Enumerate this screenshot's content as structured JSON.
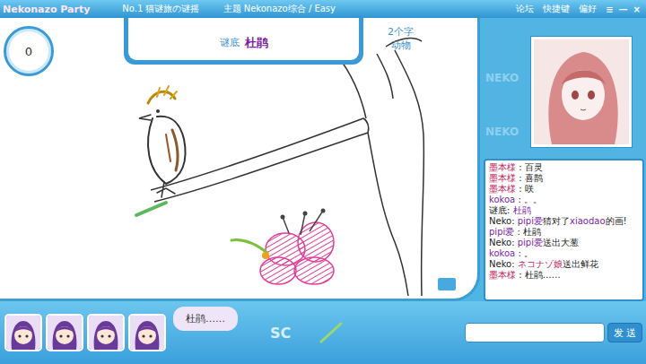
{
  "title_bar": {
    "app_name": "Nekonazo Party",
    "room": "No.1 猫谜旅の谜摇",
    "topic": "主题 Nekonazo综合 / Easy",
    "links": [
      "论坛",
      "快捷键",
      "偏好"
    ],
    "controls": [
      "≡",
      "—",
      "×"
    ]
  },
  "timer": "0",
  "answer": {
    "label": "谜底",
    "word": "杜鹃"
  },
  "hint": {
    "length": "2个字",
    "category": "动物"
  },
  "pattern_text": "NEKO",
  "chat": [
    {
      "segments": [
        {
          "text": "墨本様",
          "color": "#c2185b"
        },
        {
          "text": " : 百灵",
          "color": "#222222"
        }
      ]
    },
    {
      "segments": [
        {
          "text": "墨本様",
          "color": "#c2185b"
        },
        {
          "text": " : 喜鹊",
          "color": "#222222"
        }
      ]
    },
    {
      "segments": [
        {
          "text": "墨本様",
          "color": "#c2185b"
        },
        {
          "text": " : 咲",
          "color": "#222222"
        }
      ]
    },
    {
      "segments": [
        {
          "text": "kokoa",
          "color": "#7b1fa2"
        },
        {
          "text": " : 。。",
          "color": "#222222"
        }
      ]
    },
    {
      "segments": [
        {
          "text": "谜底: ",
          "color": "#222222"
        },
        {
          "text": "杜鹃",
          "color": "#7b1fa2"
        }
      ]
    },
    {
      "segments": [
        {
          "text": "Neko: ",
          "color": "#222222"
        },
        {
          "text": "pipi爱",
          "color": "#7b1fa2"
        },
        {
          "text": "猜对了",
          "color": "#222222"
        },
        {
          "text": "xiaodao",
          "color": "#7b1fa2"
        },
        {
          "text": "的画!",
          "color": "#222222"
        }
      ]
    },
    {
      "segments": [
        {
          "text": "pipi爱",
          "color": "#7b1fa2"
        },
        {
          "text": " : 杜鹃",
          "color": "#222222"
        }
      ]
    },
    {
      "segments": [
        {
          "text": "Neko: ",
          "color": "#222222"
        },
        {
          "text": "pipi爱",
          "color": "#7b1fa2"
        },
        {
          "text": "送出大葱",
          "color": "#222222"
        }
      ]
    },
    {
      "segments": [
        {
          "text": "kokoa",
          "color": "#7b1fa2"
        },
        {
          "text": " : 。",
          "color": "#222222"
        }
      ]
    },
    {
      "segments": [
        {
          "text": "Neko: ",
          "color": "#222222"
        },
        {
          "text": "ネコナゾ娘",
          "color": "#c2185b"
        },
        {
          "text": "送出鲜花",
          "color": "#222222"
        }
      ]
    },
    {
      "segments": [
        {
          "text": "墨本様",
          "color": "#c2185b"
        },
        {
          "text": " : 杜鹃……",
          "color": "#222222"
        }
      ]
    }
  ],
  "speech_bubble": "杜鹃……",
  "pen_label": "SC",
  "message_input": {
    "value": "",
    "send_button": "发 送"
  }
}
